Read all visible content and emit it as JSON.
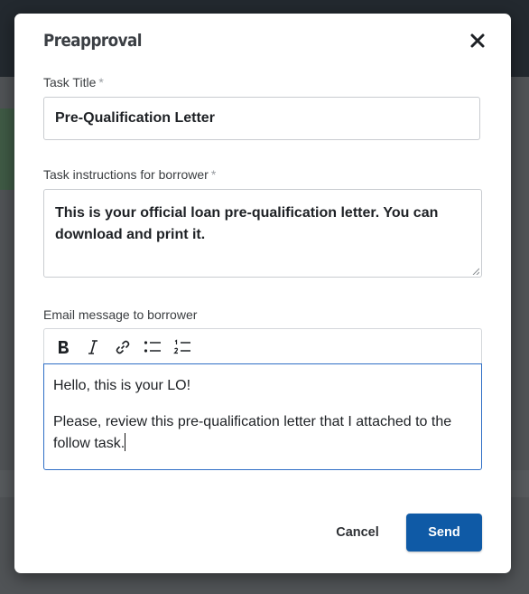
{
  "modal": {
    "title": "Preapproval",
    "close_icon": "close-icon"
  },
  "form": {
    "task_title": {
      "label": "Task Title",
      "required_mark": "*",
      "value": "Pre-Qualification Letter"
    },
    "task_instructions": {
      "label": "Task instructions for borrower",
      "required_mark": "*",
      "value": "This is your official loan pre-qualification letter. You can download and print it."
    },
    "email_message": {
      "label": "Email message to borrower",
      "toolbar": [
        "bold-icon",
        "italic-icon",
        "link-icon",
        "bulleted-list-icon",
        "numbered-list-icon"
      ],
      "paragraphs": [
        "Hello, this is your LO!",
        "Please, review this pre-qualification letter that I attached to the follow task."
      ]
    }
  },
  "actions": {
    "cancel_label": "Cancel",
    "send_label": "Send"
  },
  "colors": {
    "primary": "#0f5aa6",
    "focus_border": "#2f6fc6",
    "required_mark": "#9a9ea3"
  }
}
